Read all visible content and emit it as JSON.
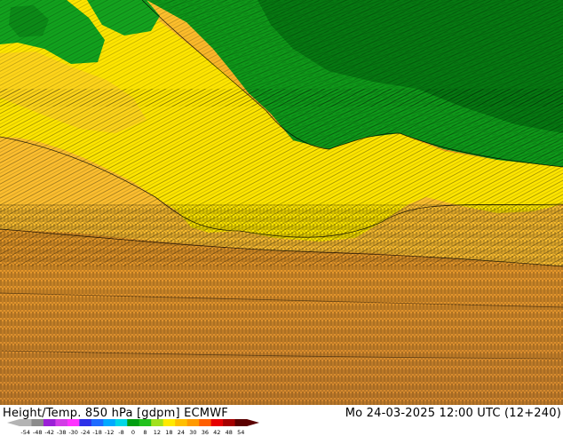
{
  "map": {
    "field_colors": {
      "dark_green": "#007d0c",
      "green": "#10a51c",
      "yellow": "#ffed00",
      "light_orange": "#ffc42e",
      "orange": "#f4a21d",
      "dark_orange": "#d8882c",
      "contour_line": "#000000"
    }
  },
  "footer": {
    "title": "Height/Temp. 850 hPa [gdpm] ECMWF",
    "datetime": "Mo 24-03-2025 12:00 UTC (12+240)"
  },
  "colorbar": {
    "labels": [
      "-54",
      "-48",
      "-42",
      "-38",
      "-30",
      "-24",
      "-18",
      "-12",
      "-8",
      "0",
      "8",
      "12",
      "18",
      "24",
      "30",
      "36",
      "42",
      "48",
      "54"
    ],
    "colors": [
      "#b4b4b4",
      "#8c8c8c",
      "#9a1fd6",
      "#d23ce6",
      "#ff32ff",
      "#2d30e8",
      "#1e6bff",
      "#00a9ff",
      "#00d7e6",
      "#009e12",
      "#22c21d",
      "#a2e11d",
      "#ffea00",
      "#ffbf00",
      "#ff9a00",
      "#ff5f00",
      "#e60000",
      "#a50000",
      "#5a0000"
    ]
  }
}
